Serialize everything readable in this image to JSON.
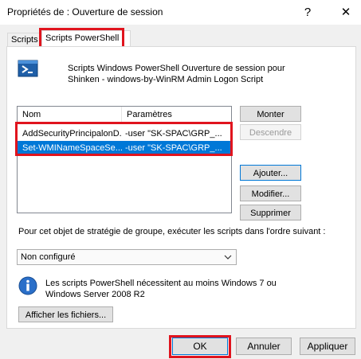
{
  "window": {
    "title": "Propriétés de : Ouverture de session",
    "help_glyph": "?",
    "close_glyph": "✕"
  },
  "tabs": [
    {
      "label": "Scripts",
      "active": false
    },
    {
      "label": "Scripts PowerShell",
      "active": true
    }
  ],
  "panel": {
    "description_line1": "Scripts Windows PowerShell Ouverture de session pour",
    "description_line2": "Shinken - windows-by-WinRM Admin Logon Script",
    "list": {
      "columns": [
        "Nom",
        "Paramètres"
      ],
      "rows": [
        {
          "name": "AddSecurityPrincipalonD...",
          "params": "-user \"SK-SPAC\\GRP_...",
          "selected": false
        },
        {
          "name": "Set-WMINameSpaceSe...",
          "params": "-user \"SK-SPAC\\GRP_...",
          "selected": true
        }
      ]
    },
    "buttons": {
      "up": "Monter",
      "down": "Descendre",
      "add": "Ajouter...",
      "edit": "Modifier...",
      "remove": "Supprimer"
    },
    "order_text": "Pour cet objet de stratégie de groupe, exécuter les scripts dans l'ordre suivant :",
    "order_select_value": "Non configuré",
    "info_line1": "Les scripts PowerShell nécessitent au moins Windows 7 ou",
    "info_line2": "Windows Server 2008 R2",
    "show_files": "Afficher les fichiers..."
  },
  "footer": {
    "ok": "OK",
    "cancel": "Annuler",
    "apply": "Appliquer"
  },
  "colors": {
    "highlight_box": "#e0141e",
    "selection": "#0078d7"
  },
  "icons": {
    "powershell": "powershell-icon",
    "info": "info-icon",
    "dropdown": "chevron-down-icon"
  }
}
